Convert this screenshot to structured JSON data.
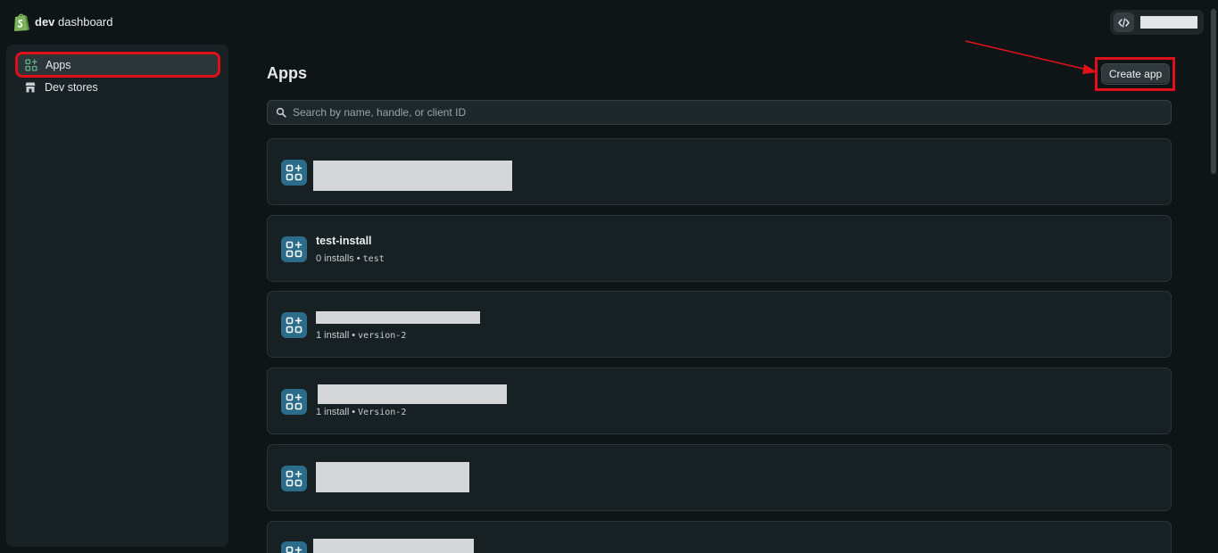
{
  "header": {
    "brand_bold": "dev",
    "brand_rest": " dashboard",
    "logo_icon": "shopify-bag-icon",
    "code_icon": "code-icon"
  },
  "sidebar": {
    "items": [
      {
        "label": "Apps",
        "icon": "apps-icon",
        "active": true
      },
      {
        "label": "Dev stores",
        "icon": "store-icon",
        "active": false
      }
    ]
  },
  "main": {
    "title": "Apps",
    "create_button": "Create app",
    "search_placeholder": "Search by name, handle, or client ID",
    "apps": [
      {
        "name": "",
        "installs": "",
        "handle": ""
      },
      {
        "name": "test-install",
        "installs": "0 installs",
        "handle": "test"
      },
      {
        "name": "",
        "installs": "1 install",
        "handle": "version-2"
      },
      {
        "name": "",
        "installs": "1 install",
        "handle": "Version-2"
      },
      {
        "name": "",
        "installs": "",
        "handle": ""
      },
      {
        "name": "",
        "installs": "",
        "handle": ""
      }
    ]
  },
  "colors": {
    "background": "#0f1517",
    "sidebar": "#182124",
    "card": "#172022",
    "app_icon": "#2a6c89",
    "highlight": "#e0101a"
  }
}
